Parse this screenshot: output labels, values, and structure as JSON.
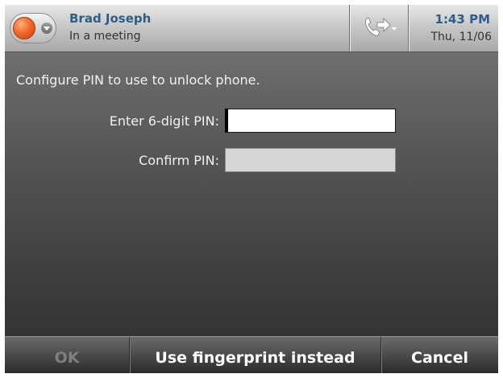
{
  "header": {
    "user_name": "Brad Joseph",
    "user_status": "In a meeting",
    "presence_color": "#f26a2a",
    "time": "1:43 PM",
    "date": "Thu, 11/06",
    "forward_icon": "call-forward-icon"
  },
  "form": {
    "instruction": "Configure PIN to use to unlock phone.",
    "pin_label": "Enter 6-digit PIN:",
    "pin_value": "",
    "confirm_label": "Confirm PIN:",
    "confirm_value": ""
  },
  "softkeys": {
    "ok_label": "OK",
    "fingerprint_label": "Use fingerprint instead",
    "cancel_label": "Cancel"
  },
  "colors": {
    "accent_text": "#2e5e88",
    "disabled_text": "#7f7f7f"
  }
}
